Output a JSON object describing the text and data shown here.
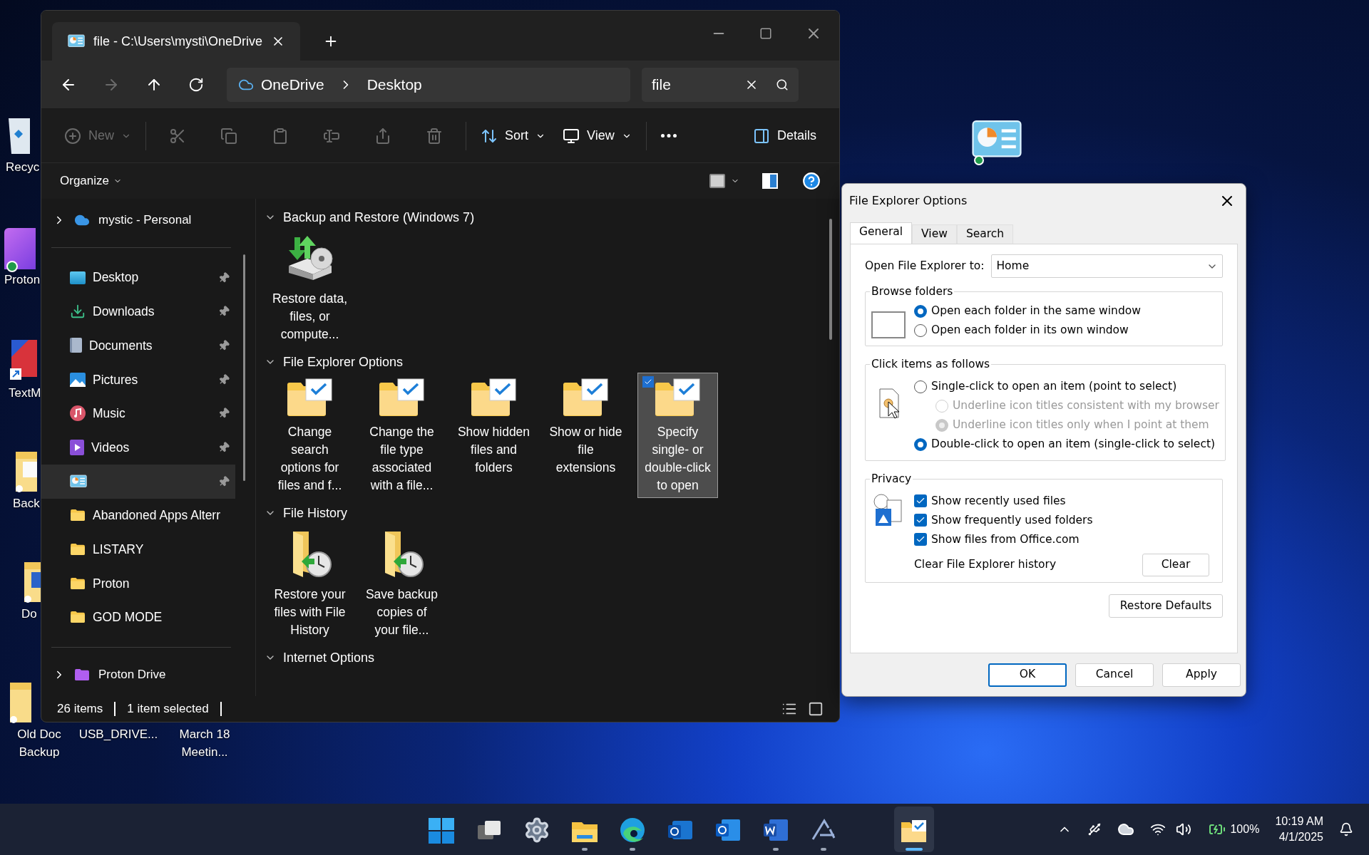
{
  "desktop": {
    "icons": [
      {
        "kind": "recycle",
        "label": "Recyc"
      },
      {
        "kind": "proton",
        "label": "Proton"
      },
      {
        "kind": "textmaker",
        "label": "TextM"
      },
      {
        "kind": "folder_doc",
        "label": "Back"
      },
      {
        "kind": "folder_word",
        "label": "Do"
      },
      {
        "kind": "folder",
        "label": "Old Doc Backup"
      },
      {
        "kind": "covered",
        "label": "USB_DRIVE..."
      },
      {
        "kind": "covered",
        "label": "March 18 Meetin..."
      },
      {
        "kind": "control_panel"
      }
    ]
  },
  "explorer": {
    "tabs": [
      {
        "title": "file - C:\\Users\\mysti\\OneDrive",
        "selected": true
      }
    ],
    "breadcrumb": [
      "OneDrive",
      "Desktop"
    ],
    "search": {
      "value": "file"
    },
    "toolbar": [
      {
        "kind": "new",
        "label": "New",
        "disabled": true
      },
      {
        "kind": "cut",
        "disabled": true
      },
      {
        "kind": "copy",
        "disabled": true
      },
      {
        "kind": "paste",
        "disabled": true
      },
      {
        "kind": "rename",
        "disabled": true
      },
      {
        "kind": "share",
        "disabled": true
      },
      {
        "kind": "delete",
        "disabled": true
      },
      {
        "kind": "sort",
        "label": "Sort",
        "disabled": false
      },
      {
        "kind": "view",
        "label": "View",
        "disabled": false
      },
      {
        "kind": "more",
        "disabled": false
      },
      {
        "kind": "details",
        "label": "Details",
        "disabled": false
      }
    ],
    "organize": "Organize",
    "nav": {
      "top": {
        "label": "mystic - Personal",
        "expanded": false
      },
      "quick_access": [
        {
          "kind": "desktop",
          "label": "Desktop",
          "pinned": true,
          "selected": false
        },
        {
          "kind": "downloads",
          "label": "Downloads",
          "pinned": true,
          "selected": false
        },
        {
          "kind": "documents",
          "label": "Documents",
          "pinned": true,
          "selected": false
        },
        {
          "kind": "pictures",
          "label": "Pictures",
          "pinned": true,
          "selected": false
        },
        {
          "kind": "music",
          "label": "Music",
          "pinned": true,
          "selected": false
        },
        {
          "kind": "videos",
          "label": "Videos",
          "pinned": true,
          "selected": false
        },
        {
          "kind": "control_panel",
          "pinned": true,
          "selected": true
        },
        {
          "kind": "folder",
          "label": "Abandoned Apps Alterr",
          "pinned": false,
          "selected": false
        },
        {
          "kind": "folder",
          "label": "LISTARY",
          "pinned": false,
          "selected": false
        },
        {
          "kind": "folder",
          "label": "Proton",
          "pinned": false,
          "selected": false
        },
        {
          "kind": "folder",
          "label": "GOD MODE",
          "pinned": false,
          "selected": false
        }
      ],
      "bottom": {
        "label": "Proton Drive",
        "expanded": false
      }
    },
    "groups": [
      {
        "title": "Backup and Restore (Windows 7)",
        "expanded": true,
        "items": [
          {
            "kind": "backup",
            "label": "Restore data, files, or compute...",
            "selected": false
          }
        ]
      },
      {
        "title": "File Explorer Options",
        "expanded": true,
        "items": [
          {
            "kind": "folder_options",
            "label": "Change search options for files and f...",
            "selected": false
          },
          {
            "kind": "folder_options",
            "label": "Change the file type associated with a file...",
            "selected": false
          },
          {
            "kind": "folder_options",
            "label": "Show hidden files and folders",
            "selected": false
          },
          {
            "kind": "folder_options",
            "label": "Show or hide file extensions",
            "selected": false
          },
          {
            "kind": "folder_options",
            "label": "Specify single- or double-click to open",
            "selected": true
          }
        ]
      },
      {
        "title": "File History",
        "expanded": true,
        "items": [
          {
            "kind": "file_history",
            "label": "Restore your files with File History",
            "selected": false
          },
          {
            "kind": "file_history",
            "label": "Save backup copies of your file...",
            "selected": false
          }
        ]
      },
      {
        "title": "Internet Options",
        "expanded": true
      }
    ],
    "status": {
      "count": "26 items",
      "selection": "1 item selected"
    }
  },
  "dialog": {
    "title": "File Explorer Options",
    "tabs": [
      {
        "label": "General",
        "selected": true
      },
      {
        "label": "View",
        "selected": false
      },
      {
        "label": "Search",
        "selected": false
      }
    ],
    "open_to": {
      "label": "Open File Explorer to:",
      "value": "Home"
    },
    "browse_folders": {
      "title": "Browse folders",
      "options": [
        {
          "label": "Open each folder in the same window",
          "selected": true,
          "disabled": false
        },
        {
          "label": "Open each folder in its own window",
          "selected": false,
          "disabled": false
        }
      ]
    },
    "click_items": {
      "title": "Click items as follows",
      "options": [
        {
          "label": "Single-click to open an item (point to select)",
          "selected": false,
          "disabled": false,
          "children": [
            {
              "label": "Underline icon titles consistent with my browser",
              "selected": false,
              "disabled": true
            },
            {
              "label": "Underline icon titles only when I point at them",
              "selected": true,
              "disabled": true
            }
          ]
        },
        {
          "label": "Double-click to open an item (single-click to select)",
          "selected": true,
          "disabled": false
        }
      ]
    },
    "privacy": {
      "title": "Privacy",
      "options": [
        {
          "label": "Show recently used files",
          "checked": true
        },
        {
          "label": "Show frequently used folders",
          "checked": true
        },
        {
          "label": "Show files from Office.com",
          "checked": true
        }
      ],
      "clear_label": "Clear File Explorer history",
      "clear_button": "Clear"
    },
    "restore_button": "Restore Defaults",
    "buttons": [
      {
        "label": "OK",
        "default": true
      },
      {
        "label": "Cancel",
        "default": false
      },
      {
        "label": "Apply",
        "default": false
      }
    ]
  },
  "taskbar": {
    "apps": [
      {
        "kind": "start",
        "running": false,
        "active": false
      },
      {
        "kind": "taskview",
        "running": false,
        "active": false
      },
      {
        "kind": "settings",
        "running": false,
        "active": false
      },
      {
        "kind": "explorer",
        "running": true,
        "active": false
      },
      {
        "kind": "edge",
        "running": true,
        "active": false
      },
      {
        "kind": "outlook_new",
        "running": false,
        "active": false
      },
      {
        "kind": "outlook",
        "running": false,
        "active": false
      },
      {
        "kind": "word",
        "running": true,
        "active": false
      },
      {
        "kind": "app",
        "running": true,
        "active": false
      },
      {
        "kind": "folder_options",
        "running": true,
        "active": true
      }
    ],
    "tray": {
      "battery": "100%",
      "time": "10:19 AM",
      "date": "4/1/2025"
    }
  }
}
